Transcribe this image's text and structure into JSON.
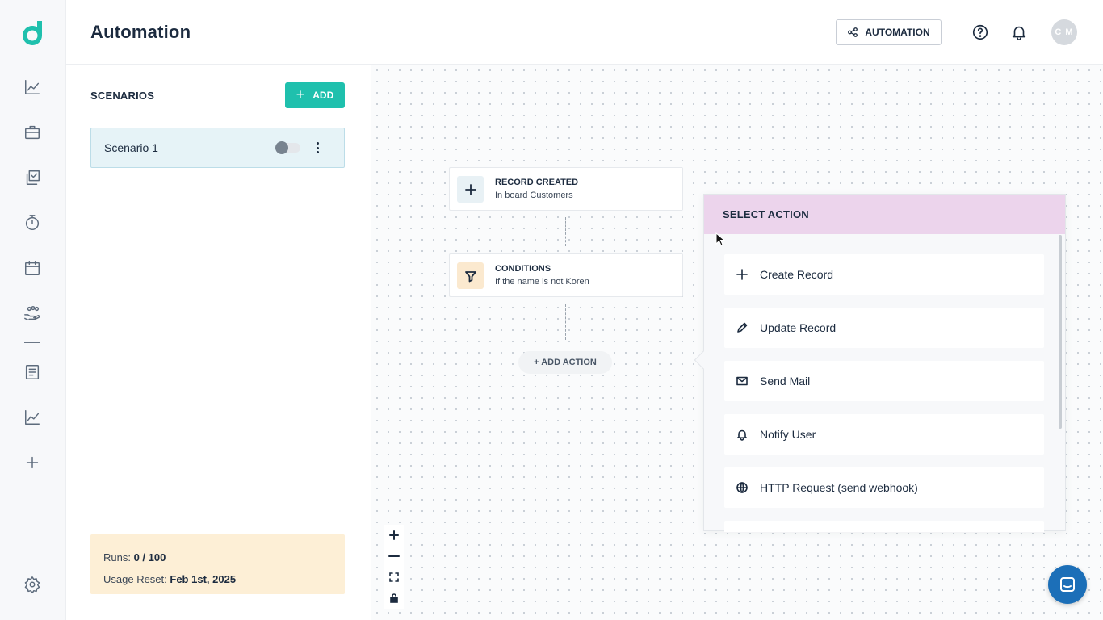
{
  "header": {
    "title": "Automation",
    "automation_button": "AUTOMATION",
    "avatar_initials": "C M"
  },
  "nav": {
    "items": [
      "chart-line-icon",
      "briefcase-icon",
      "checklist-icon",
      "stopwatch-icon",
      "calendar-icon",
      "team-hand-icon",
      "document-icon",
      "chart-line-icon",
      "plus-icon",
      "gear-icon"
    ]
  },
  "scenarios": {
    "heading": "SCENARIOS",
    "add_label": "ADD",
    "items": [
      {
        "name": "Scenario 1",
        "enabled": false
      }
    ],
    "usage": {
      "runs_label": "Runs:",
      "runs_value": "0 / 100",
      "reset_label": "Usage Reset:",
      "reset_value": "Feb 1st, 2025"
    }
  },
  "flow": {
    "trigger": {
      "title": "RECORD CREATED",
      "subtitle": "In board Customers"
    },
    "condition": {
      "title": "CONDITIONS",
      "subtitle": "If the name is not Koren"
    },
    "add_action": "+ ADD ACTION"
  },
  "select_action": {
    "title": "SELECT ACTION",
    "actions": [
      {
        "label": "Create Record",
        "icon": "plus-icon"
      },
      {
        "label": "Update Record",
        "icon": "pencil-icon"
      },
      {
        "label": "Send Mail",
        "icon": "mail-icon"
      },
      {
        "label": "Notify User",
        "icon": "bell-icon"
      },
      {
        "label": "HTTP Request (send webhook)",
        "icon": "globe-icon"
      }
    ]
  },
  "colors": {
    "brand": "#1fc0ad",
    "popover_header": "#ecd4ec",
    "usage_bg": "#fdefd6",
    "scenario_selected": "#e6f3f7",
    "chat": "#1c6fb8"
  }
}
